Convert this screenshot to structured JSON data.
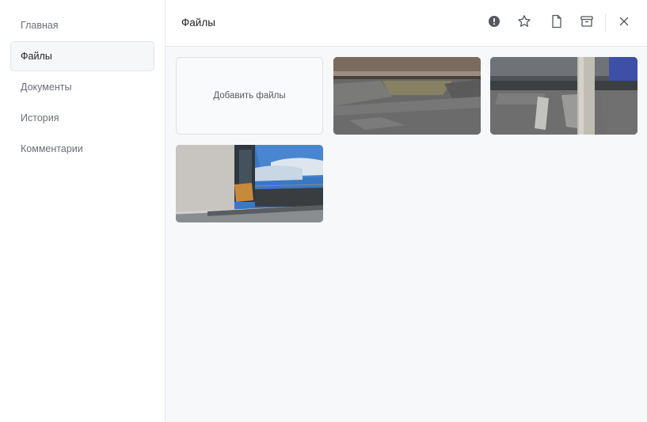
{
  "sidebar": {
    "items": [
      {
        "label": "Главная",
        "active": false
      },
      {
        "label": "Файлы",
        "active": true
      },
      {
        "label": "Документы",
        "active": false
      },
      {
        "label": "История",
        "active": false
      },
      {
        "label": "Комментарии",
        "active": false
      }
    ]
  },
  "header": {
    "title": "Файлы",
    "actions": [
      "alert-icon",
      "star-icon",
      "file-icon",
      "archive-icon",
      "close-icon"
    ]
  },
  "files": {
    "add_label": "Добавить файлы",
    "photos": [
      {
        "name": "photo-roof-gap"
      },
      {
        "name": "photo-roof-post"
      },
      {
        "name": "photo-building-roof-edge"
      }
    ]
  },
  "colors": {
    "active_bg": "#f6f7f9",
    "main_bg": "#f7f8fa",
    "border": "#e6e8ec"
  }
}
